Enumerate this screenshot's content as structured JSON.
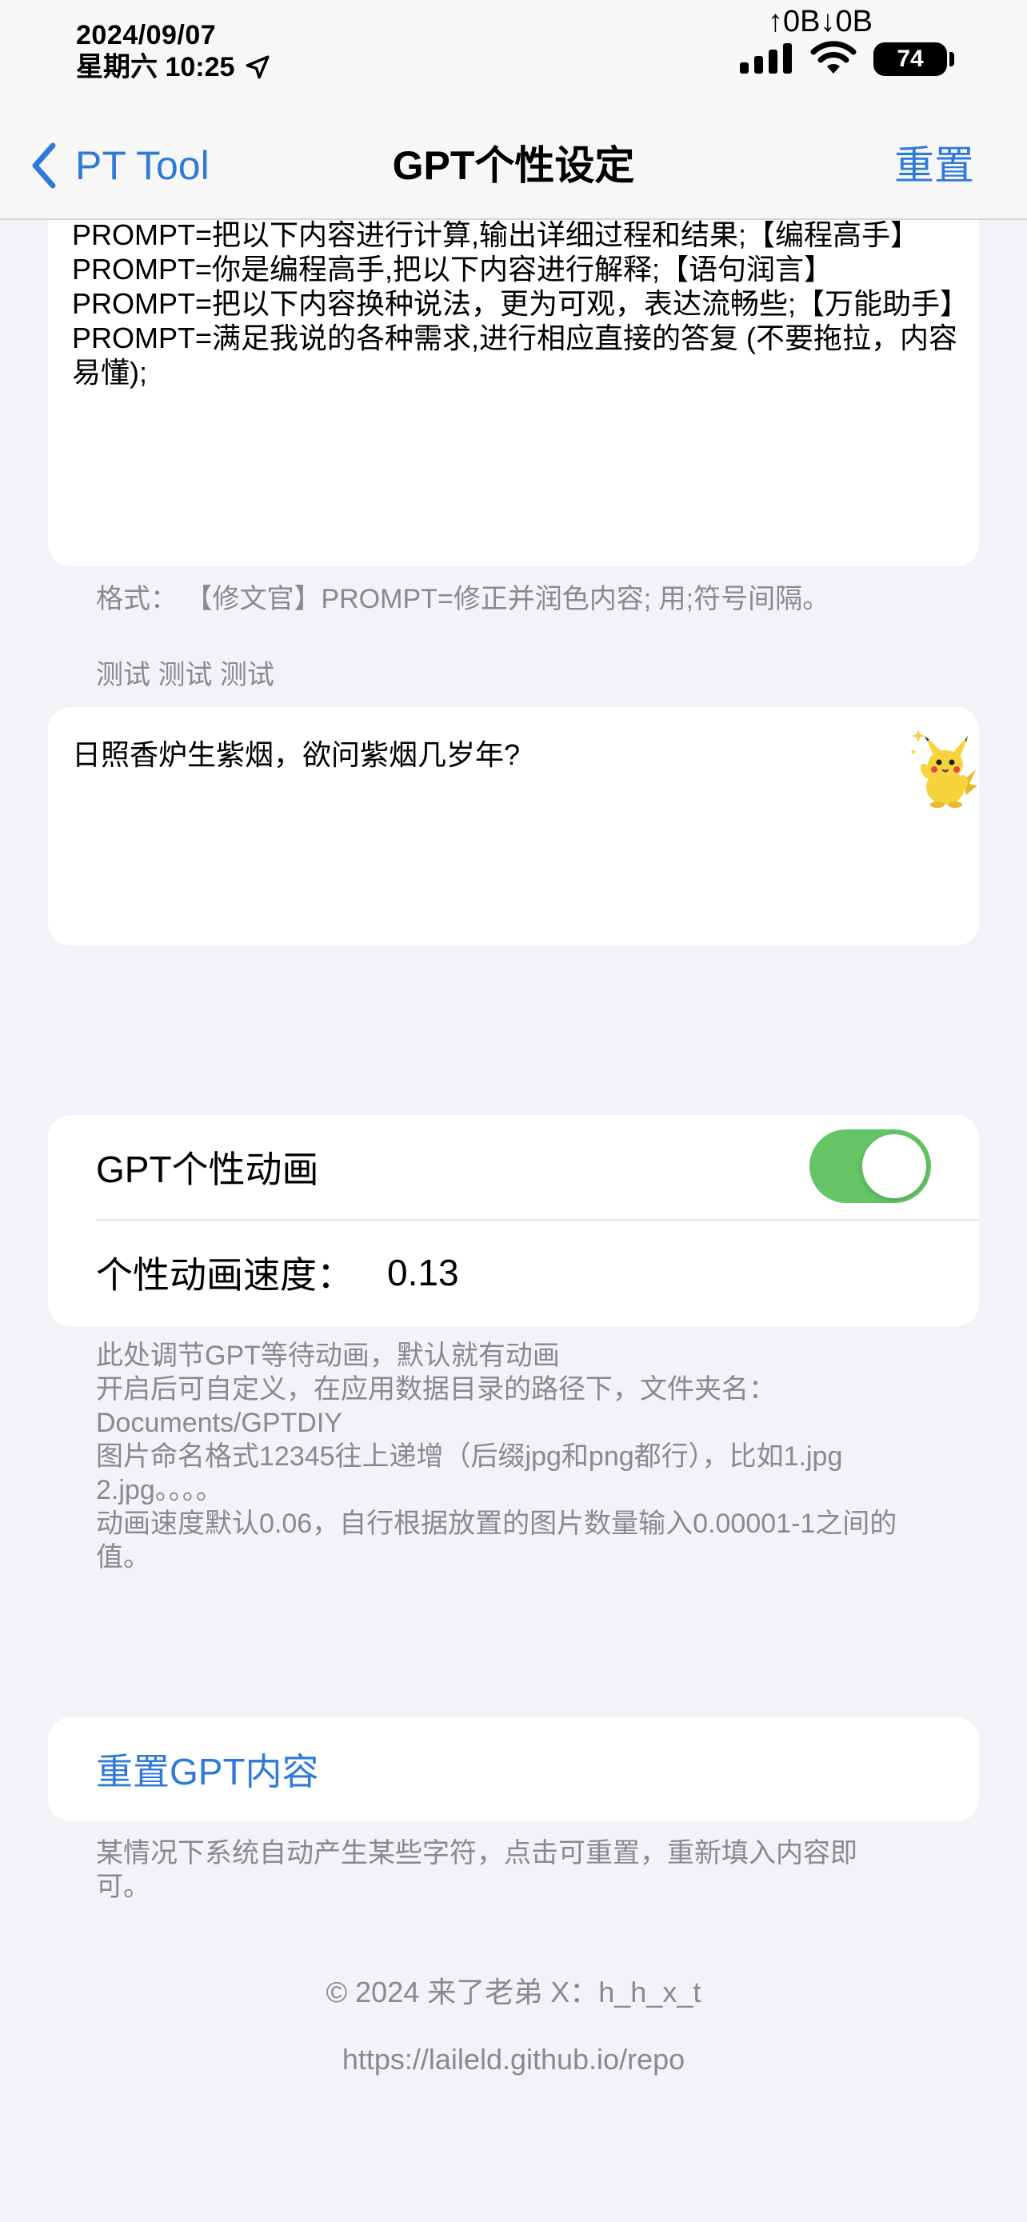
{
  "status_bar": {
    "date": "2024/09/07",
    "time": "星期六 10:25",
    "net_speed": "↑0B↓0B",
    "battery": "74",
    "location_icon": "location-arrow-icon",
    "signal_icon": "cellular-signal-icon",
    "wifi_icon": "wifi-icon"
  },
  "nav": {
    "back_label": "PT Tool",
    "title": "GPT个性设定",
    "reset_label": "重置",
    "back_icon": "chevron-left-icon"
  },
  "prompt_section": {
    "text": "PROMPT=把以下内容进行计算,输出详细过程和结果;【编程高手】PROMPT=你是编程高手,把以下内容进行解释;【语句润言】PROMPT=把以下内容换种说法，更为可观，表达流畅些;【万能助手】PROMPT=满足我说的各种需求,进行相应直接的答复 (不要拖拉，内容易懂);",
    "format_hint": "格式：  【修文官】PROMPT=修正并润色内容;  用;符号间隔。"
  },
  "test_section": {
    "label": "测试 测试 测试",
    "text": "日照香炉生紫烟，欲问紫烟几岁年?",
    "mascot_icon": "pikachu-icon"
  },
  "animation_section": {
    "toggle_label": "GPT个性动画",
    "toggle_on": true,
    "speed_label": "个性动画速度：",
    "speed_value": "0.13",
    "description": "此处调节GPT等待动画，默认就有动画\n开启后可自定义，在应用数据目录的路径下，文件夹名：Documents/GPTDIY\n图片命名格式12345往上递增（后缀jpg和png都行），比如1.jpg  2.jpg。。。。\n动画速度默认0.06，自行根据放置的图片数量输入0.00001-1之间的值。"
  },
  "reset_section": {
    "button_label": "重置GPT内容",
    "description": "某情况下系统自动产生某些字符，点击可重置，重新填入内容即可。"
  },
  "footer": {
    "copyright": "© 2024  来了老弟  X：h_h_x_t",
    "repo_url": "https://laileld.github.io/repo"
  },
  "colors": {
    "accent": "#2f7ad8",
    "toggle_on": "#65c466",
    "background": "#f2f2f7",
    "secondary_text": "#8a8a8e"
  }
}
